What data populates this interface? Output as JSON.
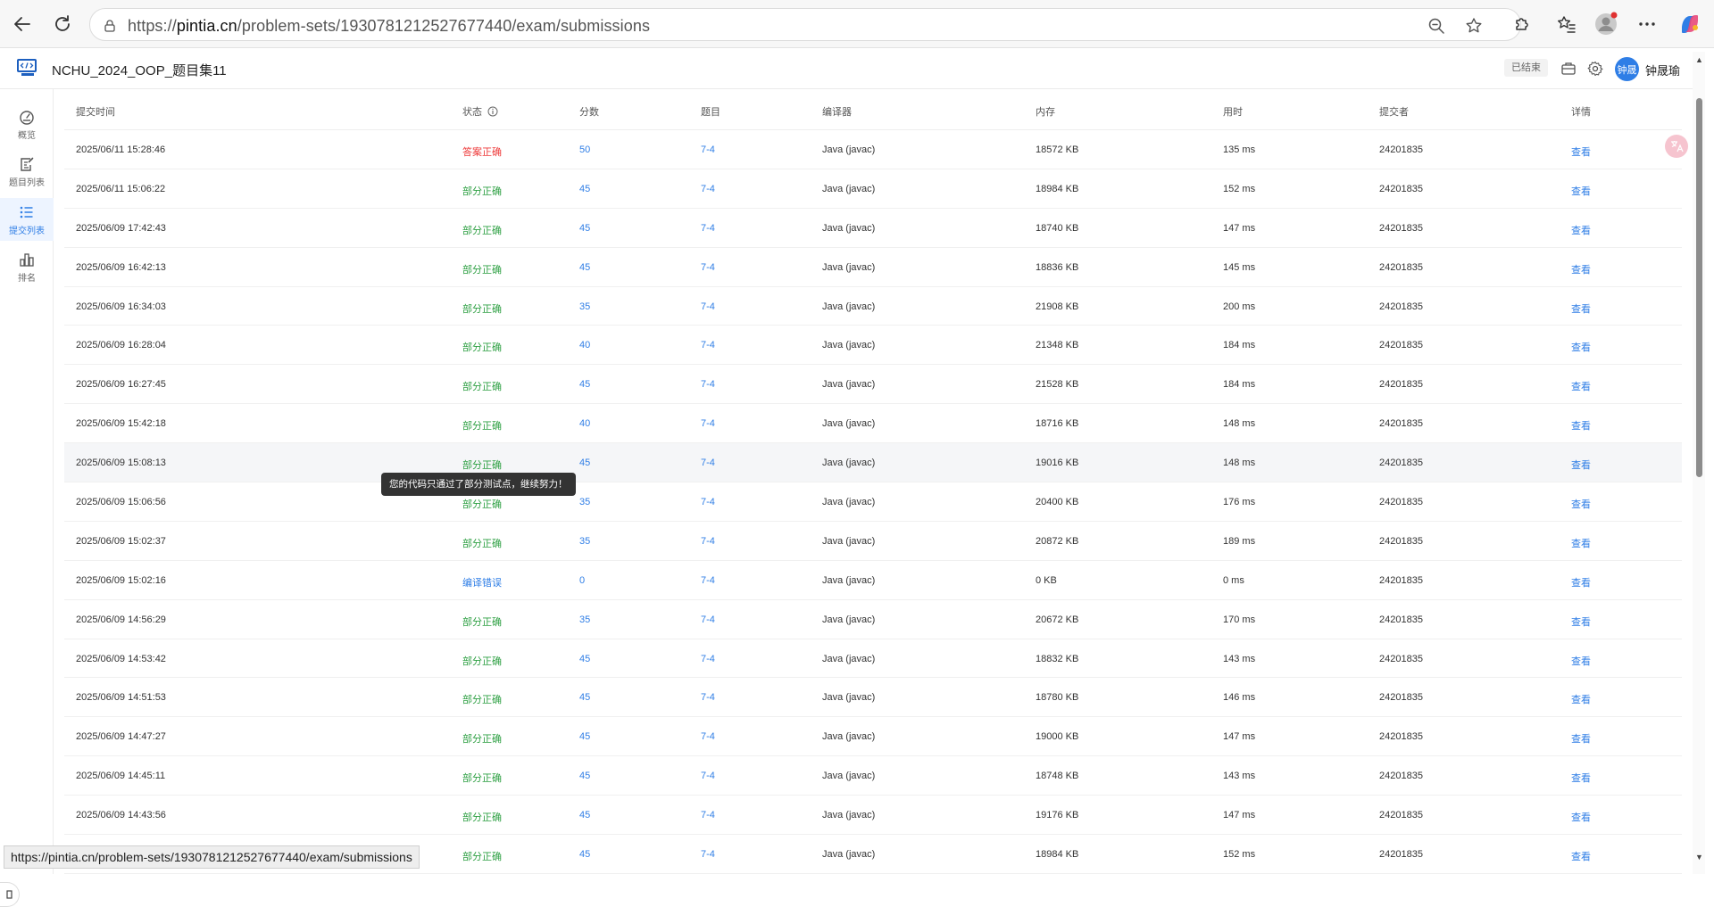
{
  "browser": {
    "url_prefix": "https://",
    "url_host": "pintia.cn",
    "url_path": "/problem-sets/1930781212527677440/exam/submissions"
  },
  "header": {
    "title": "NCHU_2024_OOP_题目集11",
    "status_badge": "已结束",
    "avatar_text": "钟晟",
    "user_name": "钟晟瑜"
  },
  "sidebar": {
    "items": [
      {
        "label": "概览"
      },
      {
        "label": "题目列表"
      },
      {
        "label": "提交列表"
      },
      {
        "label": "排名"
      }
    ]
  },
  "table": {
    "columns": [
      "提交时间",
      "状态",
      "分数",
      "题目",
      "编译器",
      "内存",
      "用时",
      "提交者",
      "详情"
    ],
    "rows": [
      {
        "time": "2025/06/11 15:28:46",
        "status": "答案正确",
        "status_type": "correct",
        "score": "50",
        "problem": "7-4",
        "compiler": "Java (javac)",
        "memory": "18572 KB",
        "duration": "135 ms",
        "submitter": "24201835",
        "detail": "查看"
      },
      {
        "time": "2025/06/11 15:06:22",
        "status": "部分正确",
        "status_type": "partial",
        "score": "45",
        "problem": "7-4",
        "compiler": "Java (javac)",
        "memory": "18984 KB",
        "duration": "152 ms",
        "submitter": "24201835",
        "detail": "查看"
      },
      {
        "time": "2025/06/09 17:42:43",
        "status": "部分正确",
        "status_type": "partial",
        "score": "45",
        "problem": "7-4",
        "compiler": "Java (javac)",
        "memory": "18740 KB",
        "duration": "147 ms",
        "submitter": "24201835",
        "detail": "查看"
      },
      {
        "time": "2025/06/09 16:42:13",
        "status": "部分正确",
        "status_type": "partial",
        "score": "45",
        "problem": "7-4",
        "compiler": "Java (javac)",
        "memory": "18836 KB",
        "duration": "145 ms",
        "submitter": "24201835",
        "detail": "查看"
      },
      {
        "time": "2025/06/09 16:34:03",
        "status": "部分正确",
        "status_type": "partial",
        "score": "35",
        "problem": "7-4",
        "compiler": "Java (javac)",
        "memory": "21908 KB",
        "duration": "200 ms",
        "submitter": "24201835",
        "detail": "查看"
      },
      {
        "time": "2025/06/09 16:28:04",
        "status": "部分正确",
        "status_type": "partial",
        "score": "40",
        "problem": "7-4",
        "compiler": "Java (javac)",
        "memory": "21348 KB",
        "duration": "184 ms",
        "submitter": "24201835",
        "detail": "查看"
      },
      {
        "time": "2025/06/09 16:27:45",
        "status": "部分正确",
        "status_type": "partial",
        "score": "45",
        "problem": "7-4",
        "compiler": "Java (javac)",
        "memory": "21528 KB",
        "duration": "184 ms",
        "submitter": "24201835",
        "detail": "查看"
      },
      {
        "time": "2025/06/09 15:42:18",
        "status": "部分正确",
        "status_type": "partial",
        "score": "40",
        "problem": "7-4",
        "compiler": "Java (javac)",
        "memory": "18716 KB",
        "duration": "148 ms",
        "submitter": "24201835",
        "detail": "查看"
      },
      {
        "time": "2025/06/09 15:08:13",
        "status": "部分正确",
        "status_type": "partial",
        "score": "45",
        "problem": "7-4",
        "compiler": "Java (javac)",
        "memory": "19016 KB",
        "duration": "148 ms",
        "submitter": "24201835",
        "detail": "查看",
        "hover": true
      },
      {
        "time": "2025/06/09 15:06:56",
        "status": "部分正确",
        "status_type": "partial",
        "score": "35",
        "problem": "7-4",
        "compiler": "Java (javac)",
        "memory": "20400 KB",
        "duration": "176 ms",
        "submitter": "24201835",
        "detail": "查看"
      },
      {
        "time": "2025/06/09 15:02:37",
        "status": "部分正确",
        "status_type": "partial",
        "score": "35",
        "problem": "7-4",
        "compiler": "Java (javac)",
        "memory": "20872 KB",
        "duration": "189 ms",
        "submitter": "24201835",
        "detail": "查看"
      },
      {
        "time": "2025/06/09 15:02:16",
        "status": "编译错误",
        "status_type": "compile",
        "score": "0",
        "problem": "7-4",
        "compiler": "Java (javac)",
        "memory": "0 KB",
        "duration": "0 ms",
        "submitter": "24201835",
        "detail": "查看"
      },
      {
        "time": "2025/06/09 14:56:29",
        "status": "部分正确",
        "status_type": "partial",
        "score": "35",
        "problem": "7-4",
        "compiler": "Java (javac)",
        "memory": "20672 KB",
        "duration": "170 ms",
        "submitter": "24201835",
        "detail": "查看"
      },
      {
        "time": "2025/06/09 14:53:42",
        "status": "部分正确",
        "status_type": "partial",
        "score": "45",
        "problem": "7-4",
        "compiler": "Java (javac)",
        "memory": "18832 KB",
        "duration": "143 ms",
        "submitter": "24201835",
        "detail": "查看"
      },
      {
        "time": "2025/06/09 14:51:53",
        "status": "部分正确",
        "status_type": "partial",
        "score": "45",
        "problem": "7-4",
        "compiler": "Java (javac)",
        "memory": "18780 KB",
        "duration": "146 ms",
        "submitter": "24201835",
        "detail": "查看"
      },
      {
        "time": "2025/06/09 14:47:27",
        "status": "部分正确",
        "status_type": "partial",
        "score": "45",
        "problem": "7-4",
        "compiler": "Java (javac)",
        "memory": "19000 KB",
        "duration": "147 ms",
        "submitter": "24201835",
        "detail": "查看"
      },
      {
        "time": "2025/06/09 14:45:11",
        "status": "部分正确",
        "status_type": "partial",
        "score": "45",
        "problem": "7-4",
        "compiler": "Java (javac)",
        "memory": "18748 KB",
        "duration": "143 ms",
        "submitter": "24201835",
        "detail": "查看"
      },
      {
        "time": "2025/06/09 14:43:56",
        "status": "部分正确",
        "status_type": "partial",
        "score": "45",
        "problem": "7-4",
        "compiler": "Java (javac)",
        "memory": "19176 KB",
        "duration": "147 ms",
        "submitter": "24201835",
        "detail": "查看"
      },
      {
        "time": "",
        "status": "部分正确",
        "status_type": "partial",
        "score": "45",
        "problem": "7-4",
        "compiler": "Java (javac)",
        "memory": "18984 KB",
        "duration": "152 ms",
        "submitter": "24201835",
        "detail": "查看"
      }
    ]
  },
  "tooltip": {
    "text": "您的代码只通过了部分测试点，继续努力！"
  },
  "statusbar": {
    "url": "https://pintia.cn/problem-sets/1930781212527677440/exam/submissions"
  },
  "colors": {
    "accent": "#2f7ee6",
    "correct": "#ee3a3a",
    "partial": "#2ea043",
    "compile_error": "#2f7ee6"
  },
  "icons": {
    "back": "arrow-left-icon",
    "reload": "reload-icon",
    "site_info": "site-info-icon",
    "zoom": "zoom-out-icon",
    "favorite": "star-icon",
    "extensions": "puzzle-icon",
    "favorites_list": "favorites-icon",
    "profile": "profile-icon",
    "more": "more-icon",
    "copilot": "copilot-icon"
  }
}
